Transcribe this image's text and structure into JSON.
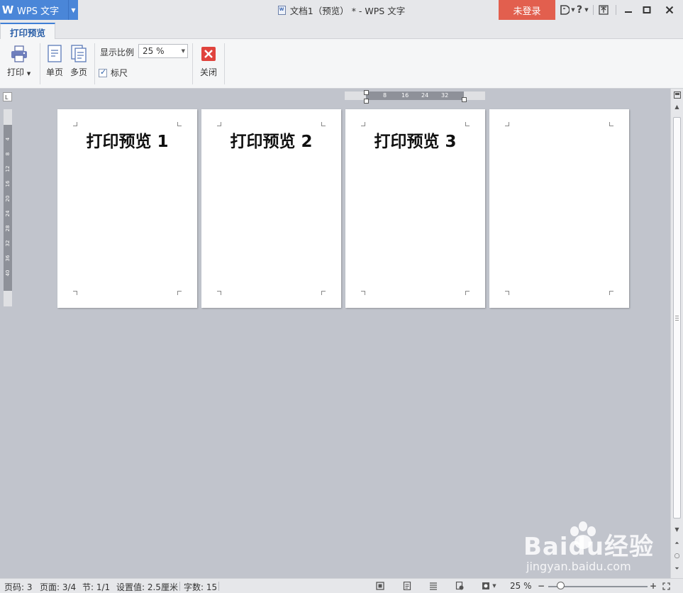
{
  "window": {
    "app_logo": "W",
    "app_name": "WPS 文字",
    "doc_title": "文档1（预览） * - WPS 文字",
    "login_label": "未登录",
    "help_label": "?"
  },
  "ribbon": {
    "active_tab": "打印预览",
    "print_label": "打印",
    "single_page_label": "单页",
    "multi_page_label": "多页",
    "zoom_label": "显示比例",
    "zoom_value": "25 %",
    "ruler_label": "标尺",
    "ruler_checked": true,
    "close_label": "关闭"
  },
  "pages": [
    {
      "title": "打印预览 1"
    },
    {
      "title": "打印预览 2"
    },
    {
      "title": "打印预览 3"
    },
    {
      "title": ""
    }
  ],
  "hruler": {
    "ticks": [
      "8",
      "16",
      "24",
      "32"
    ]
  },
  "vruler": {
    "ticks": [
      "4",
      "8",
      "12",
      "16",
      "20",
      "24",
      "28",
      "32",
      "36",
      "40"
    ]
  },
  "status": {
    "page_num": "页码: 3",
    "pages": "页面: 3/4",
    "section": "节: 1/1",
    "setting": "设置值: 2.5厘米",
    "word_count": "字数: 15",
    "zoom": "25 %"
  },
  "watermark": {
    "main": "Baidu经验",
    "sub": "jingyan.baidu.com"
  },
  "colors": {
    "accent": "#4a86d8",
    "login": "#e25f4e",
    "workspace": "#c1c4cc"
  }
}
